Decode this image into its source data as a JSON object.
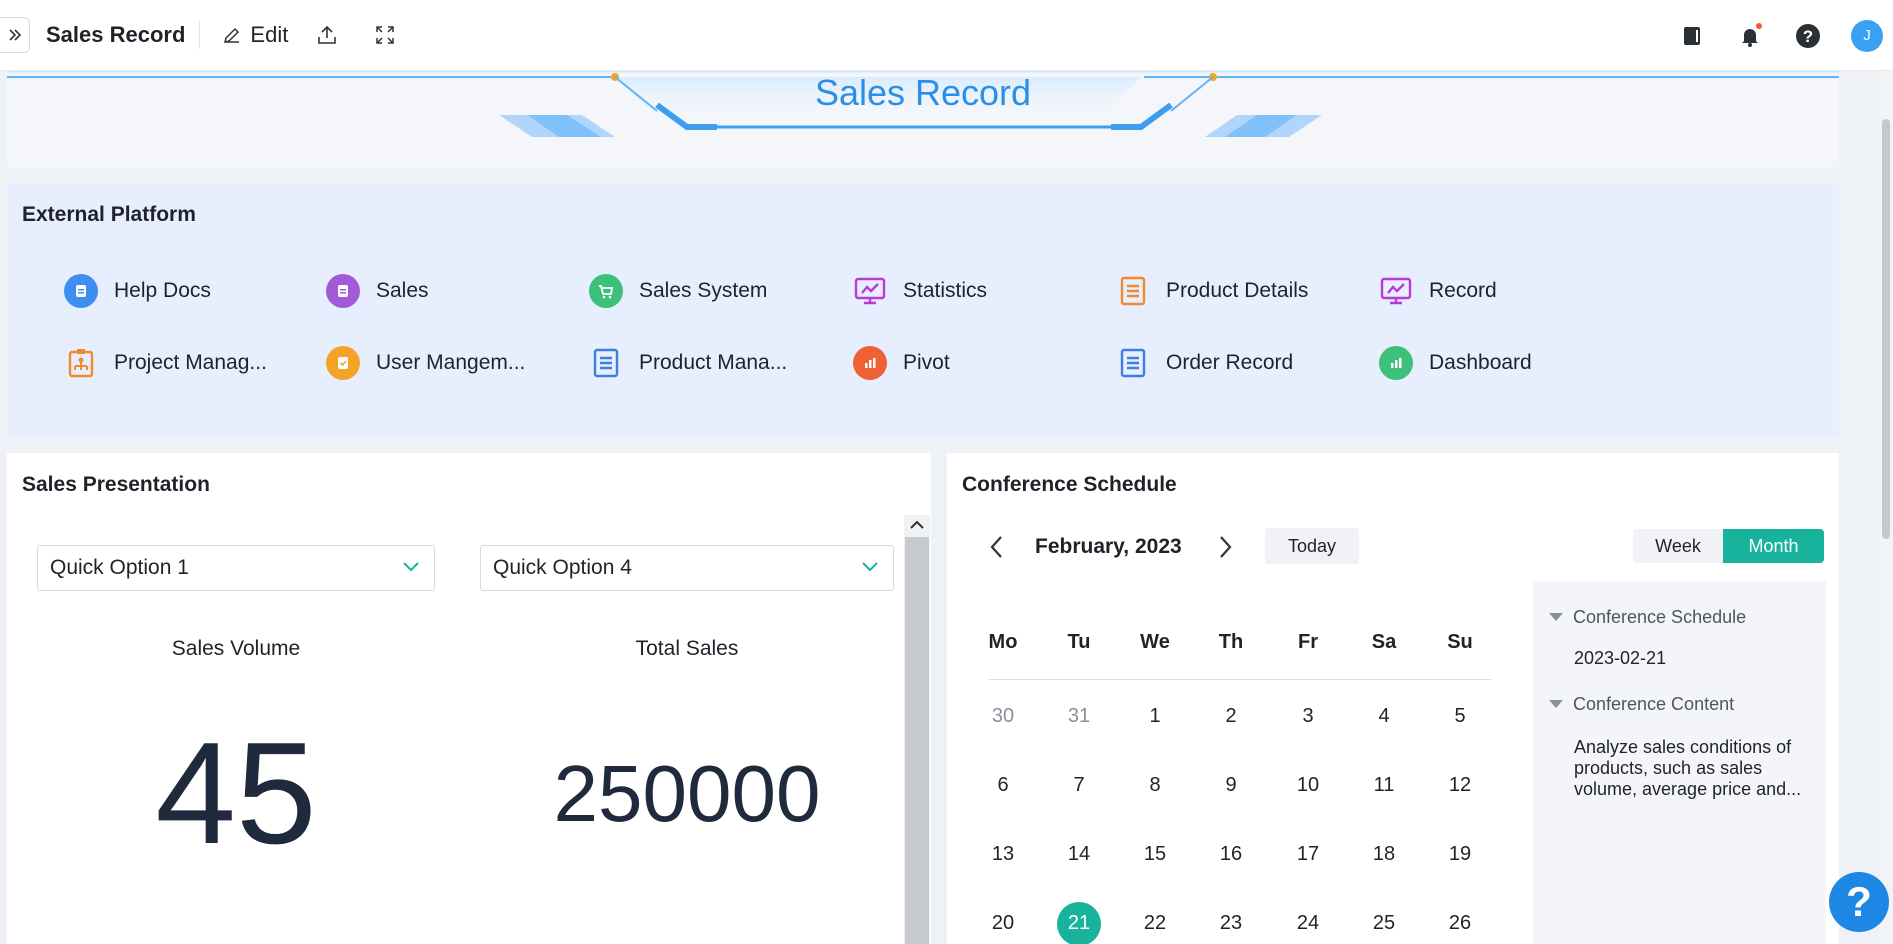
{
  "topbar": {
    "title": "Sales Record",
    "edit_label": "Edit",
    "avatar_initial": "J"
  },
  "banner": {
    "title": "Sales Record"
  },
  "external_platform": {
    "title": "External Platform",
    "items": [
      {
        "label": "Help Docs",
        "icon": "doc-circle-icon",
        "color": "#3d8ef0"
      },
      {
        "label": "Sales",
        "icon": "doc-circle-icon",
        "color": "#a25bd8"
      },
      {
        "label": "Sales System",
        "icon": "cart-circle-icon",
        "color": "#3cc07a"
      },
      {
        "label": "Statistics",
        "icon": "monitor-chart-icon",
        "color": "#b93ad6"
      },
      {
        "label": "Product Details",
        "icon": "list-doc-icon",
        "color": "#f08a2d"
      },
      {
        "label": "Record",
        "icon": "monitor-chart-icon",
        "color": "#b93ad6"
      },
      {
        "label": "Project Manag...",
        "icon": "org-chart-icon",
        "color": "#f08a2d"
      },
      {
        "label": "User Mangem...",
        "icon": "check-circle-icon",
        "color": "#f3a325"
      },
      {
        "label": "Product Mana...",
        "icon": "list-doc-icon",
        "color": "#3d7fe0"
      },
      {
        "label": "Pivot",
        "icon": "bar-circle-icon",
        "color": "#ef6035"
      },
      {
        "label": "Order Record",
        "icon": "list-doc-icon",
        "color": "#3d7fe0"
      },
      {
        "label": "Dashboard",
        "icon": "bar-circle-icon",
        "color": "#3cc07a"
      }
    ]
  },
  "sales_presentation": {
    "title": "Sales Presentation",
    "select1": "Quick Option 1",
    "select2": "Quick Option 4",
    "metric1_label": "Sales Volume",
    "metric1_value": "45",
    "metric2_label": "Total Sales",
    "metric2_value": "250000"
  },
  "conference": {
    "title": "Conference Schedule",
    "month": "February, 2023",
    "today": "Today",
    "week": "Week",
    "month_btn": "Month",
    "weekdays": [
      "Mo",
      "Tu",
      "We",
      "Th",
      "Fr",
      "Sa",
      "Su"
    ],
    "weeks": [
      [
        "30",
        "31",
        "1",
        "2",
        "3",
        "4",
        "5"
      ],
      [
        "6",
        "7",
        "8",
        "9",
        "10",
        "11",
        "12"
      ],
      [
        "13",
        "14",
        "15",
        "16",
        "17",
        "18",
        "19"
      ],
      [
        "20",
        "21",
        "22",
        "23",
        "24",
        "25",
        "26"
      ]
    ],
    "muted_days": [
      "30",
      "31"
    ],
    "selected_day": "21",
    "panel": {
      "schedule_label": "Conference Schedule",
      "schedule_value": "2023-02-21",
      "content_label": "Conference Content",
      "content_line1": "Analyze sales conditions of",
      "content_line2": "products, such as sales",
      "content_line3": "volume, average price and..."
    },
    "accent": "#17b39c"
  }
}
